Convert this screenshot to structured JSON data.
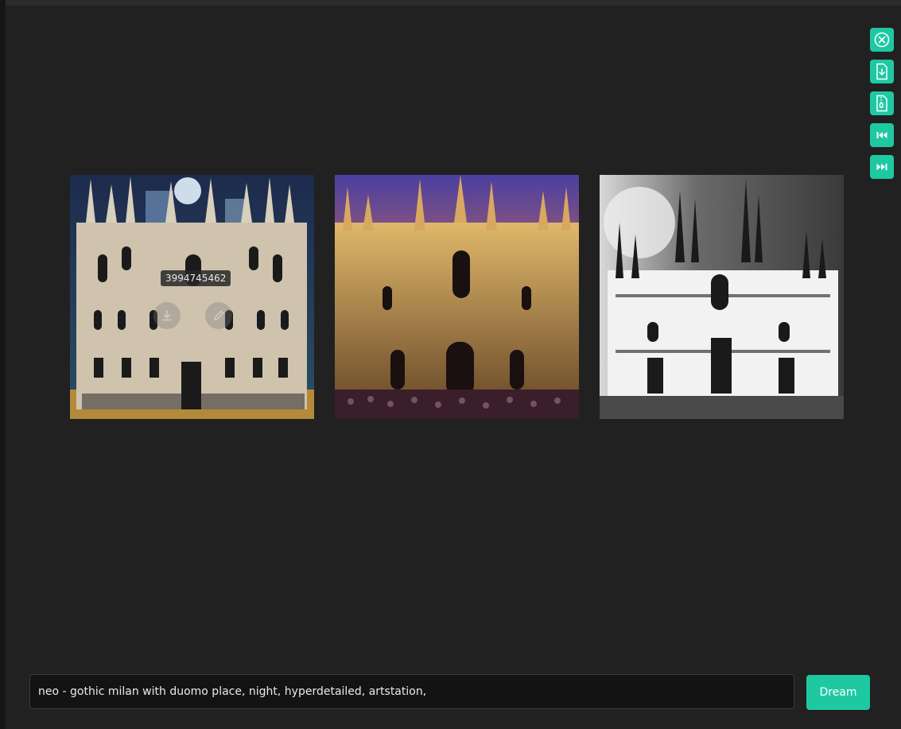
{
  "toolbar": {
    "buttons": [
      {
        "icon": "close-circle-icon"
      },
      {
        "icon": "download-file-icon"
      },
      {
        "icon": "zip-file-icon"
      },
      {
        "icon": "skip-back-icon"
      },
      {
        "icon": "skip-forward-icon"
      }
    ],
    "accent": "#1ec9a2"
  },
  "gallery": {
    "images": [
      {
        "style": "ornate white facade, dark blue sky"
      },
      {
        "style": "golden facade, purple sunset sky, crowd"
      },
      {
        "style": "black and white ink facade"
      }
    ],
    "hover": {
      "seed": "3994745462",
      "actions": [
        {
          "icon": "download-icon"
        },
        {
          "icon": "edit-icon"
        }
      ]
    }
  },
  "prompt": {
    "value": "neo - gothic milan with duomo place, night, hyperdetailed, artstation,"
  },
  "dream_button": {
    "label": "Dream"
  }
}
